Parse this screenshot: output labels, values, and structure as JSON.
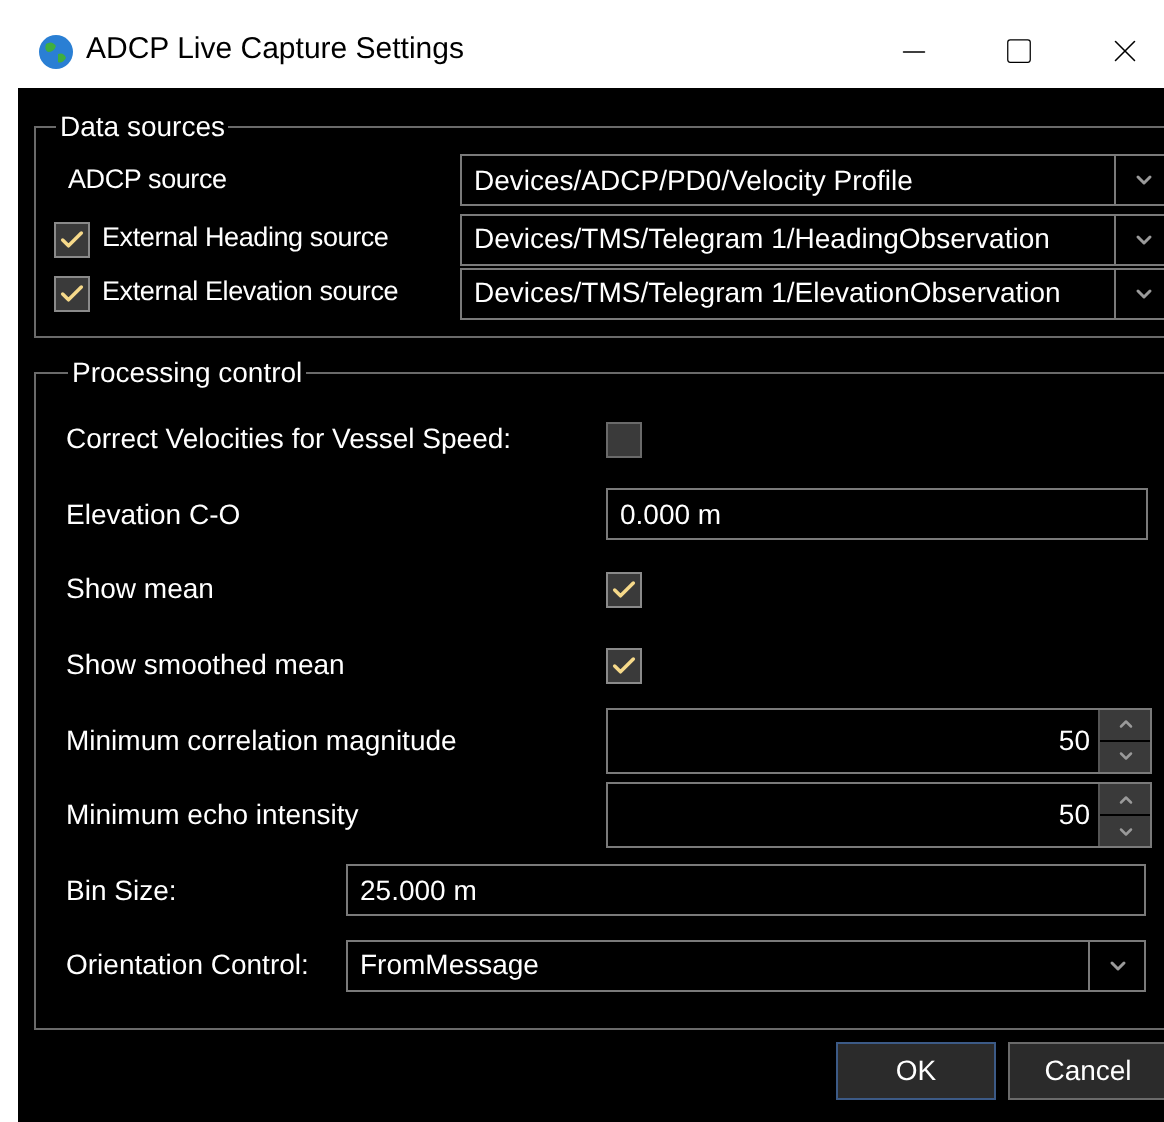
{
  "window": {
    "title": "ADCP Live Capture Settings"
  },
  "data_sources": {
    "title": "Data sources",
    "rows": [
      {
        "kind": "plain",
        "label": "ADCP source",
        "value": "Devices/ADCP/PD0/Velocity Profile"
      },
      {
        "kind": "check",
        "label": "External Heading source",
        "checked": true,
        "value": "Devices/TMS/Telegram 1/HeadingObservation"
      },
      {
        "kind": "check",
        "label": "External Elevation source",
        "checked": true,
        "value": "Devices/TMS/Telegram 1/ElevationObservation"
      }
    ]
  },
  "processing_control": {
    "title": "Processing control",
    "rows": [
      {
        "kind": "check",
        "label": "Correct Velocities for Vessel Speed:",
        "checked": false
      },
      {
        "kind": "field",
        "label": "Elevation C-O",
        "value": "0.000 m"
      },
      {
        "kind": "check",
        "label": "Show mean",
        "checked": true
      },
      {
        "kind": "check",
        "label": "Show smoothed mean",
        "checked": true
      },
      {
        "kind": "spin",
        "label": "Minimum correlation magnitude",
        "value": "50"
      },
      {
        "kind": "spin",
        "label": "Minimum echo intensity",
        "value": "50"
      },
      {
        "kind": "entry",
        "label": "Bin Size:",
        "value": "25.000 m"
      },
      {
        "kind": "select",
        "label": "Orientation Control:",
        "value": "FromMessage"
      }
    ]
  },
  "buttons": [
    {
      "label": "OK",
      "default": true
    },
    {
      "label": "Cancel",
      "default": false
    }
  ]
}
